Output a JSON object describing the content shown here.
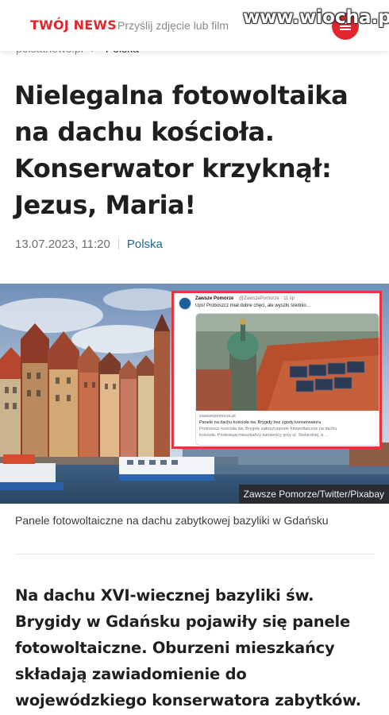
{
  "header": {
    "brand": "TWÓJ NEWS",
    "send_link": "Przyślij zdjęcie lub film",
    "watermark": "www.wiocha.pl",
    "accent_color": "#e2262d"
  },
  "breadcrumb": {
    "site": "polsatnews.pl",
    "separator": "›",
    "section": "Polska"
  },
  "article": {
    "headline_lines": [
      "Nielegalna fotowoltaika",
      "na dachu kościoła.",
      "Konserwator krzyknął:",
      "Jezus, Maria!"
    ],
    "date": "13.07.2023, 11:20",
    "section": "Polska",
    "section_color": "#1f6b8f"
  },
  "hero": {
    "credit": "Zawsze Pomorze/Twitter/Pixabay",
    "tweet": {
      "name": "Zawsze Pomorze",
      "handle": "@ZawszePomorze · 11 lip",
      "text": "Ups! Proboszcz miał dobre chęci, ale wyszło średnio...",
      "card_domain": "zawszepomorze.pl",
      "card_title": "Panele na dachu kościoła św. Brygidy bez zgody konserwatora",
      "card_desc_1": "Proboszcz kościoła św. Brygidy założył panele fotowoltaiczne na dachu",
      "card_desc_2": "kościoła. Protestują mieszkańcy kamienicy przy ul. Stolarskiej, a ..."
    }
  },
  "caption": "Panele fotowoltaiczne na dachu zabytkowej bazyliki w Gdańsku",
  "lead_lines": [
    "Na dachu XVI-wiecznej bazyliki św.",
    "Brygidy w Gdańsku pojawiły się panele",
    "fotowoltaiczne. Oburzeni mieszkańcy",
    "składają zawiadomienie do",
    "wojewódzkiego konserwatora zabytków."
  ]
}
